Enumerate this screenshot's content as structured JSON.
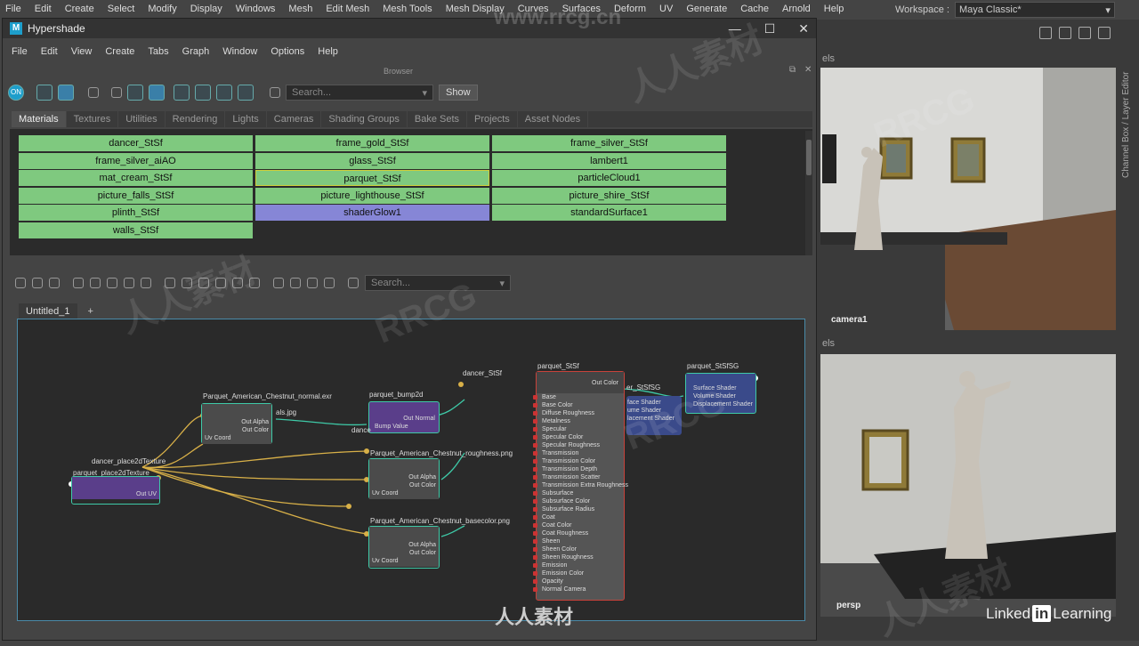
{
  "maya_menu": [
    "File",
    "Edit",
    "Create",
    "Select",
    "Modify",
    "Display",
    "Windows",
    "Mesh",
    "Edit Mesh",
    "Mesh Tools",
    "Mesh Display",
    "Curves",
    "Surfaces",
    "Deform",
    "UV",
    "Generate",
    "Cache",
    "Arnold",
    "Help"
  ],
  "workspace": {
    "label": "Workspace :",
    "value": "Maya Classic*"
  },
  "right_panel": {
    "sidetab": "Channel Box / Layer Editor",
    "top_cam": "camera1",
    "bot_cam": "persp",
    "els_top": "els",
    "els_bot": "els"
  },
  "hypershade": {
    "title": "Hypershade",
    "menu": [
      "File",
      "Edit",
      "View",
      "Create",
      "Tabs",
      "Graph",
      "Window",
      "Options",
      "Help"
    ],
    "browser_label": "Browser",
    "toggle_on": "ON",
    "search_placeholder": "Search...",
    "show_label": "Show",
    "tabs": [
      "Materials",
      "Textures",
      "Utilities",
      "Rendering",
      "Lights",
      "Cameras",
      "Shading Groups",
      "Bake Sets",
      "Projects",
      "Asset Nodes"
    ],
    "materials": [
      [
        "dancer_StSf",
        "frame_gold_StSf",
        "frame_silver_StSf"
      ],
      [
        "frame_silver_aiAO",
        "glass_StSf",
        "lambert1"
      ],
      [
        "mat_cream_StSf",
        "parquet_StSf",
        "particleCloud1"
      ],
      [
        "picture_falls_StSf",
        "picture_lighthouse_StSf",
        "picture_shire_StSf"
      ],
      [
        "plinth_StSf",
        "shaderGlow1",
        "standardSurface1"
      ],
      [
        "walls_StSf"
      ]
    ],
    "graph_search_placeholder": "Search...",
    "graph_tab": "Untitled_1",
    "graph_tab_add": "+"
  },
  "nodes": {
    "place2d_title": "dancer_place2dTexture",
    "place2d_inner": "parquet_place2dTexture",
    "place2d_out": "Out UV",
    "file_normal_title": "Parquet_American_Chestnut_normal.exr",
    "file_ports": [
      "Out Alpha",
      "Out Color",
      "Uv Coord"
    ],
    "file_partial": "als.jpg",
    "bump_title": "parquet_bump2d",
    "bump_out": "Out Normal",
    "bump_in": "Bump Value",
    "dancer_partial": "dance",
    "file_rough_title": "Parquet_American_Chestnut_roughness.png",
    "file_base_title": "Parquet_American_Chestnut_basecolor.png",
    "dancer_title": "dancer_StSf",
    "out_color": "Out Color",
    "parquet_title": "parquet_StSf",
    "sg_title": "parquet_StSfSG",
    "sg_ports": [
      "Surface Shader",
      "Volume Shader",
      "Displacement Shader"
    ],
    "sg_partial": "er_StSfSG",
    "sg_partial_ports": [
      "face Shader",
      "ume Shader",
      "lacement Shader"
    ],
    "standard_ports": [
      "Base",
      "Base Color",
      "Diffuse Roughness",
      "Metalness",
      "Specular",
      "Specular Color",
      "Specular Roughness",
      "Transmission",
      "Transmission Color",
      "Transmission Depth",
      "Transmission Scatter",
      "Transmission Extra Roughness",
      "Subsurface",
      "Subsurface Color",
      "Subsurface Radius",
      "Coat",
      "Coat Color",
      "Coat Roughness",
      "Sheen",
      "Sheen Color",
      "Sheen Roughness",
      "Emission",
      "Emission Color",
      "Opacity",
      "Normal Camera"
    ]
  },
  "footer": {
    "logo": "人人素材",
    "linkedin_a": "Linked",
    "linkedin_in": "in",
    "linkedin_b": "Learning"
  },
  "watermarks": [
    "www.rrcg.cn",
    "RRCG",
    "人人素材"
  ],
  "colors": {
    "material_green": "#7fc97f",
    "material_blue": "#8686d6",
    "accent": "#1d9ecb",
    "node_border": "#3ec9a7"
  }
}
